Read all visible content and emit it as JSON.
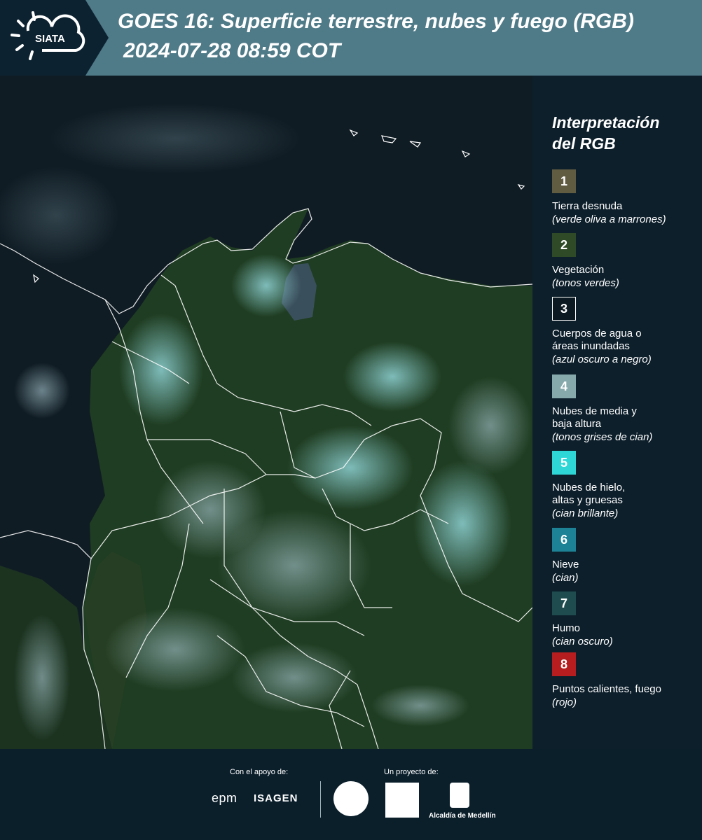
{
  "header": {
    "logo_text": "SIATA",
    "title": "GOES 16: Superficie terrestre, nubes y fuego (RGB)",
    "datetime": "2024-07-28 08:59 COT"
  },
  "legend": {
    "title_line1": "Interpretación",
    "title_line2": "del RGB",
    "items": [
      {
        "num": "1",
        "color": "#5f5c42",
        "border": "#5f5c42",
        "label1": "Tierra desnuda",
        "label2": "",
        "note": "(verde oliva a marrones)"
      },
      {
        "num": "2",
        "color": "#2f4a27",
        "border": "#2f4a27",
        "label1": "Vegetación",
        "label2": "",
        "note": "(tonos verdes)"
      },
      {
        "num": "3",
        "color": "#0b1a22",
        "border": "#ffffff",
        "label1": "Cuerpos de agua o",
        "label2": "áreas inundadas",
        "note": "(azul oscuro a negro)"
      },
      {
        "num": "4",
        "color": "#86a9ac",
        "border": "#86a9ac",
        "label1": "Nubes de media y",
        "label2": "baja altura",
        "note": "(tonos grises de cian)"
      },
      {
        "num": "5",
        "color": "#2fd6d6",
        "border": "#2fd6d6",
        "label1": "Nubes de hielo,",
        "label2": "altas y gruesas",
        "note": "(cian brillante)"
      },
      {
        "num": "6",
        "color": "#1e8296",
        "border": "#1e8296",
        "label1": "Nieve",
        "label2": "",
        "note": "(cian)"
      },
      {
        "num": "7",
        "color": "#1f4c4e",
        "border": "#1f4c4e",
        "label1": "Humo",
        "label2": "",
        "note": "(cian oscuro)"
      },
      {
        "num": "8",
        "color": "#b71d1e",
        "border": "#b71d1e",
        "label1": "Puntos calientes, fuego",
        "label2": "",
        "note": "(rojo)"
      }
    ]
  },
  "footer": {
    "support_label": "Con el apoyo de:",
    "project_label": "Un proyecto de:",
    "epm": "epm",
    "isagen": "ISAGEN",
    "alcaldia": "Alcaldía de Medellín"
  }
}
